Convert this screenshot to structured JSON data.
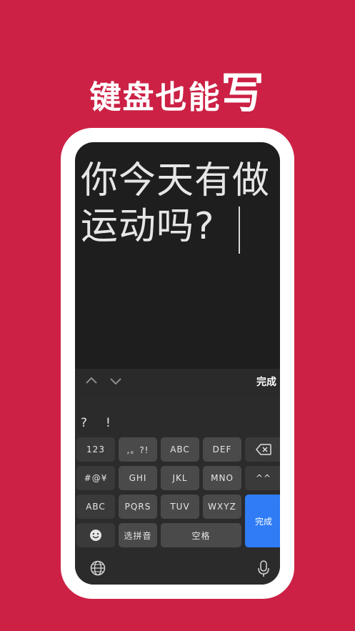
{
  "headline": {
    "main": "键盘也能",
    "big": "写"
  },
  "editor": {
    "line1": "你今天有做",
    "line2": "运动吗?"
  },
  "toolbar": {
    "up_icon": "chevron-up-icon",
    "down_icon": "chevron-down-icon",
    "done_label": "完成"
  },
  "candidates": [
    "?",
    "!"
  ],
  "keys": {
    "row1": [
      "123",
      ",。?!",
      "ABC",
      "DEF"
    ],
    "row2": [
      "#@¥",
      "GHI",
      "JKL",
      "MNO",
      "^^"
    ],
    "row3": [
      "ABC",
      "PQRS",
      "TUV",
      "WXYZ"
    ],
    "row4": [
      "选拼音",
      "空格"
    ],
    "enter": "完成",
    "backspace_icon": "backspace-icon",
    "emoji_icon": "emoji-icon"
  },
  "bottom": {
    "globe_icon": "globe-icon",
    "mic_icon": "microphone-icon"
  },
  "colors": {
    "background": "#cc2145",
    "accent": "#2f7cf6"
  }
}
